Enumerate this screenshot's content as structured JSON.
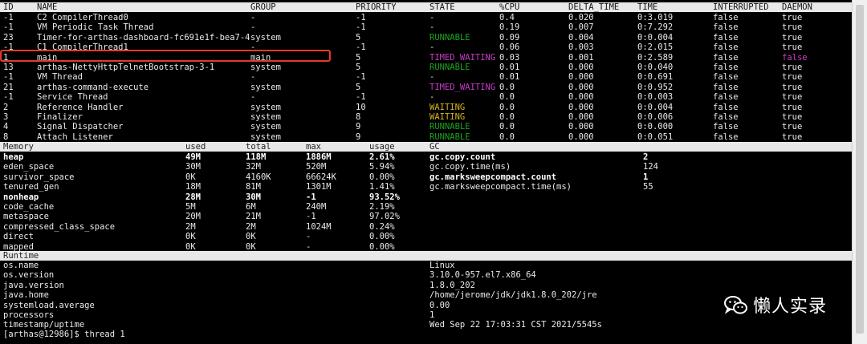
{
  "thread_table": {
    "headers": [
      "ID",
      "NAME",
      "GROUP",
      "PRIORITY",
      "STATE",
      "%CPU",
      "DELTA_TIME",
      "TIME",
      "INTERRUPTED",
      "DAEMON"
    ],
    "rows": [
      {
        "id": "-1",
        "name": "C2 CompilerThread0",
        "group": "-",
        "priority": "-1",
        "state": "-",
        "cpu": "0.4",
        "delta": "0.020",
        "time": "0:3.019",
        "interrupted": "false",
        "daemon": "true"
      },
      {
        "id": "-1",
        "name": "VM Periodic Task Thread",
        "group": "-",
        "priority": "-1",
        "state": "-",
        "cpu": "0.19",
        "delta": "0.007",
        "time": "0:7.292",
        "interrupted": "false",
        "daemon": "true"
      },
      {
        "id": "23",
        "name": "Timer-for-arthas-dashboard-fc691e1f-bea7-4",
        "group": "system",
        "priority": "5",
        "state": "RUNNABLE",
        "cpu": "0.09",
        "delta": "0.004",
        "time": "0:0.004",
        "interrupted": "false",
        "daemon": "true"
      },
      {
        "id": "-1",
        "name": "C1 CompilerThread1",
        "group": "-",
        "priority": "-1",
        "state": "-",
        "cpu": "0.06",
        "delta": "0.003",
        "time": "0:2.015",
        "interrupted": "false",
        "daemon": "true"
      },
      {
        "id": "1",
        "name": "main",
        "group": "main",
        "priority": "5",
        "state": "TIMED_WAITING",
        "cpu": "0.03",
        "delta": "0.001",
        "time": "0:2.589",
        "interrupted": "false",
        "daemon": "false"
      },
      {
        "id": "13",
        "name": "arthas-NettyHttpTelnetBootstrap-3-1",
        "group": "system",
        "priority": "5",
        "state": "RUNNABLE",
        "cpu": "0.01",
        "delta": "0.000",
        "time": "0:0.040",
        "interrupted": "false",
        "daemon": "true"
      },
      {
        "id": "-1",
        "name": "VM Thread",
        "group": "-",
        "priority": "-1",
        "state": "-",
        "cpu": "0.01",
        "delta": "0.000",
        "time": "0:0.691",
        "interrupted": "false",
        "daemon": "true"
      },
      {
        "id": "21",
        "name": "arthas-command-execute",
        "group": "system",
        "priority": "5",
        "state": "TIMED_WAITING",
        "cpu": "0.0",
        "delta": "0.000",
        "time": "0:0.952",
        "interrupted": "false",
        "daemon": "true"
      },
      {
        "id": "-1",
        "name": "Service Thread",
        "group": "-",
        "priority": "-1",
        "state": "-",
        "cpu": "0.0",
        "delta": "0.000",
        "time": "0:0.003",
        "interrupted": "false",
        "daemon": "true"
      },
      {
        "id": "2",
        "name": "Reference Handler",
        "group": "system",
        "priority": "10",
        "state": "WAITING",
        "cpu": "0.0",
        "delta": "0.000",
        "time": "0:0.004",
        "interrupted": "false",
        "daemon": "true"
      },
      {
        "id": "3",
        "name": "Finalizer",
        "group": "system",
        "priority": "8",
        "state": "WAITING",
        "cpu": "0.0",
        "delta": "0.000",
        "time": "0:0.006",
        "interrupted": "false",
        "daemon": "true"
      },
      {
        "id": "4",
        "name": "Signal Dispatcher",
        "group": "system",
        "priority": "9",
        "state": "RUNNABLE",
        "cpu": "0.0",
        "delta": "0.000",
        "time": "0:0.000",
        "interrupted": "false",
        "daemon": "true"
      },
      {
        "id": "8",
        "name": "Attach Listener",
        "group": "system",
        "priority": "9",
        "state": "RUNNABLE",
        "cpu": "0.0",
        "delta": "0.000",
        "time": "0:0.051",
        "interrupted": "false",
        "daemon": "true"
      }
    ]
  },
  "memory": {
    "headers": [
      "Memory",
      "used",
      "total",
      "max",
      "usage"
    ],
    "rows": [
      {
        "name": "heap",
        "used": "49M",
        "total": "118M",
        "max": "1886M",
        "usage": "2.61%",
        "bold": true
      },
      {
        "name": "eden_space",
        "used": "30M",
        "total": "32M",
        "max": "520M",
        "usage": "5.94%",
        "bold": false
      },
      {
        "name": "survivor_space",
        "used": "0K",
        "total": "4160K",
        "max": "66624K",
        "usage": "0.00%",
        "bold": false
      },
      {
        "name": "tenured_gen",
        "used": "18M",
        "total": "81M",
        "max": "1301M",
        "usage": "1.41%",
        "bold": false
      },
      {
        "name": "nonheap",
        "used": "28M",
        "total": "30M",
        "max": "-1",
        "usage": "93.52%",
        "bold": true
      },
      {
        "name": "code_cache",
        "used": "5M",
        "total": "6M",
        "max": "240M",
        "usage": "2.19%",
        "bold": false
      },
      {
        "name": "metaspace",
        "used": "20M",
        "total": "21M",
        "max": "-1",
        "usage": "97.02%",
        "bold": false
      },
      {
        "name": "compressed_class_space",
        "used": "2M",
        "total": "2M",
        "max": "1024M",
        "usage": "0.24%",
        "bold": false
      },
      {
        "name": "direct",
        "used": "0K",
        "total": "0K",
        "max": "-",
        "usage": "0.00%",
        "bold": false
      },
      {
        "name": "mapped",
        "used": "0K",
        "total": "0K",
        "max": "-",
        "usage": "0.00%",
        "bold": false
      }
    ]
  },
  "gc": {
    "header": "GC",
    "rows": [
      {
        "name": "gc.copy.count",
        "value": "2",
        "bold": true
      },
      {
        "name": "gc.copy.time(ms)",
        "value": "124",
        "bold": false
      },
      {
        "name": "gc.marksweepcompact.count",
        "value": "1",
        "bold": true
      },
      {
        "name": "gc.marksweepcompact.time(ms)",
        "value": "55",
        "bold": false
      }
    ]
  },
  "runtime": {
    "header": "Runtime",
    "rows": [
      {
        "name": "os.name",
        "value": "Linux"
      },
      {
        "name": "os.version",
        "value": "3.10.0-957.el7.x86_64"
      },
      {
        "name": "java.version",
        "value": "1.8.0_202"
      },
      {
        "name": "java.home",
        "value": "/home/jerome/jdk/jdk1.8.0_202/jre"
      },
      {
        "name": "systemload.average",
        "value": "0.00"
      },
      {
        "name": "processors",
        "value": "1"
      },
      {
        "name": "timestamp/uptime",
        "value": "Wed Sep 22 17:03:31 CST 2021/5545s"
      }
    ]
  },
  "prompt": "[arthas@12986]$ thread 1",
  "watermark": {
    "text": "懒人实录",
    "icon": "wechat-icon"
  },
  "colors": {
    "runnable": "#1fa31f",
    "timed_waiting": "#c83ac8",
    "waiting": "#d3b51f",
    "highlight": "#e23b2b"
  }
}
